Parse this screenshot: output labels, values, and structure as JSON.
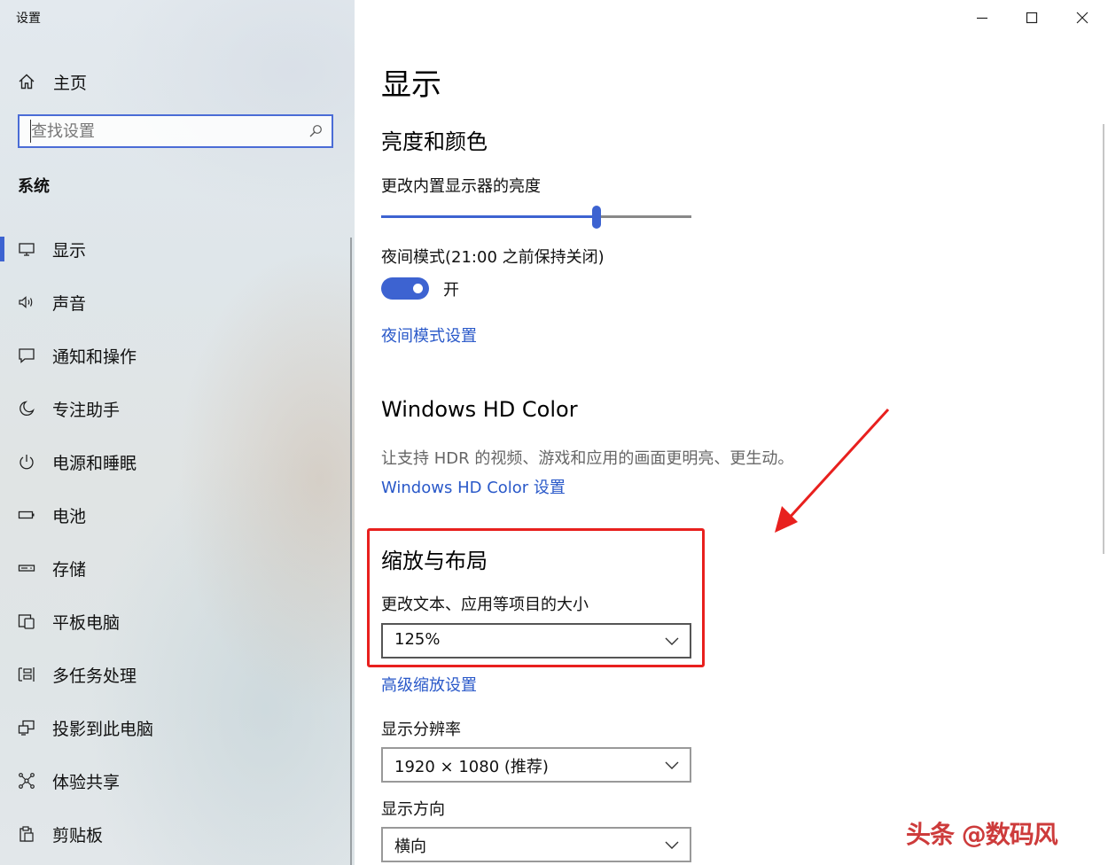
{
  "window": {
    "title": "设置",
    "controls": {
      "minimize": "minimize-icon",
      "maximize": "maximize-icon",
      "close": "close-icon"
    }
  },
  "sidebar": {
    "home_label": "主页",
    "search_placeholder": "查找设置",
    "section_title": "系统",
    "items": [
      {
        "label": "显示",
        "icon": "monitor-icon",
        "active": true
      },
      {
        "label": "声音",
        "icon": "speaker-icon"
      },
      {
        "label": "通知和操作",
        "icon": "notification-icon"
      },
      {
        "label": "专注助手",
        "icon": "moon-icon"
      },
      {
        "label": "电源和睡眠",
        "icon": "power-icon"
      },
      {
        "label": "电池",
        "icon": "battery-icon"
      },
      {
        "label": "存储",
        "icon": "storage-icon"
      },
      {
        "label": "平板电脑",
        "icon": "tablet-icon"
      },
      {
        "label": "多任务处理",
        "icon": "multitask-icon"
      },
      {
        "label": "投影到此电脑",
        "icon": "project-icon"
      },
      {
        "label": "体验共享",
        "icon": "share-icon"
      },
      {
        "label": "剪贴板",
        "icon": "clipboard-icon"
      }
    ]
  },
  "main": {
    "title": "显示",
    "brightness": {
      "heading": "亮度和颜色",
      "slider_label": "更改内置显示器的亮度",
      "slider_value": 0.695
    },
    "night_mode": {
      "label": "夜间模式(21:00 之前保持关闭)",
      "toggle_state": "开",
      "toggle_on": true,
      "settings_link": "夜间模式设置"
    },
    "hd_color": {
      "heading": "Windows HD Color",
      "description": "让支持 HDR 的视频、游戏和应用的画面更明亮、更生动。",
      "settings_link": "Windows HD Color 设置"
    },
    "scale_layout": {
      "heading": "缩放与布局",
      "scale_label": "更改文本、应用等项目的大小",
      "scale_value": "125%",
      "advanced_link": "高级缩放设置",
      "resolution_label": "显示分辨率",
      "resolution_value": "1920 × 1080 (推荐)",
      "orientation_label": "显示方向",
      "orientation_value": "横向"
    }
  },
  "watermark": "头条 @数码风",
  "colors": {
    "accent": "#3d63d1",
    "link": "#2a59c9",
    "annotation": "#e8201e"
  }
}
